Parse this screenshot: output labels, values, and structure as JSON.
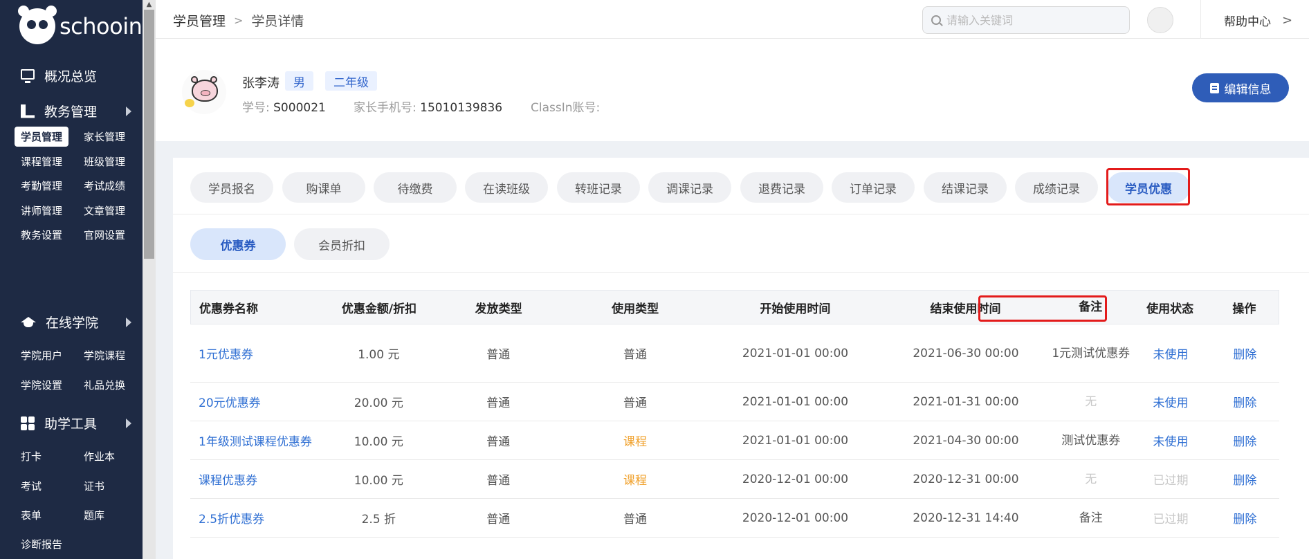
{
  "brand": {
    "name": "schooin"
  },
  "sidebar": {
    "sections": [
      {
        "label": "概况总览",
        "icon": "monitor-icon"
      },
      {
        "label": "教务管理",
        "icon": "book-icon"
      },
      {
        "label": "在线学院",
        "icon": "graduation-cap-icon"
      },
      {
        "label": "助学工具",
        "icon": "grid-icon"
      }
    ],
    "items": [
      "学员管理",
      "家长管理",
      "课程管理",
      "班级管理",
      "考勤管理",
      "考试成绩",
      "讲师管理",
      "文章管理",
      "教务设置",
      "官网设置",
      "学院用户",
      "学院课程",
      "学院设置",
      "礼品兑换",
      "打卡",
      "作业本",
      "考试",
      "证书",
      "表单",
      "题库",
      "诊断报告"
    ]
  },
  "header": {
    "breadcrumb": [
      "学员管理",
      "学员详情"
    ],
    "search_placeholder": "请输入关键词",
    "help": "帮助中心"
  },
  "student": {
    "name": "张李涛",
    "gender": "男",
    "grade": "二年级",
    "id_label": "学号:",
    "id_value": "S000021",
    "phone_label": "家长手机号:",
    "phone_value": "15010139836",
    "classin_label": "ClassIn账号:",
    "classin_value": "",
    "edit_button": "编辑信息"
  },
  "tabs": [
    "学员报名",
    "购课单",
    "待缴费",
    "在读班级",
    "转班记录",
    "调课记录",
    "退费记录",
    "订单记录",
    "结课记录",
    "成绩记录",
    "学员优惠"
  ],
  "active_tab": "学员优惠",
  "subtabs": [
    "优惠券",
    "会员折扣"
  ],
  "active_subtab": "优惠券",
  "table": {
    "columns": [
      "优惠券名称",
      "优惠金额/折扣",
      "发放类型",
      "使用类型",
      "开始使用时间",
      "结束使用时间",
      "备注",
      "使用状态",
      "操作"
    ],
    "rows": [
      {
        "name": "1元优惠券",
        "amount": "1.00 元",
        "issue": "普通",
        "use": "普通",
        "start": "2021-01-01 00:00",
        "end": "2021-06-30 00:00",
        "note": "1元测试优惠券",
        "status": "未使用",
        "action": "删除"
      },
      {
        "name": "20元优惠券",
        "amount": "20.00 元",
        "issue": "普通",
        "use": "普通",
        "start": "2021-01-01 00:00",
        "end": "2021-01-31 00:00",
        "note": "无",
        "status": "未使用",
        "action": "删除"
      },
      {
        "name": "1年级测试课程优惠券",
        "amount": "10.00 元",
        "issue": "普通",
        "use": "课程",
        "start": "2021-01-01 00:00",
        "end": "2021-04-30 00:00",
        "note": "测试优惠券",
        "status": "未使用",
        "action": "删除"
      },
      {
        "name": "课程优惠券",
        "amount": "10.00 元",
        "issue": "普通",
        "use": "课程",
        "start": "2020-12-01 00:00",
        "end": "2020-12-31 00:00",
        "note": "无",
        "status": "已过期",
        "action": "删除"
      },
      {
        "name": "2.5折优惠券",
        "amount": "2.5 折",
        "issue": "普通",
        "use": "普通",
        "start": "2020-12-01 00:00",
        "end": "2020-12-31 14:40",
        "note": "备注",
        "status": "已过期",
        "action": "删除"
      }
    ]
  },
  "colors": {
    "sidebar_bg": "#1e2a44",
    "primary": "#2f5db8",
    "link": "#2f6fd3",
    "orange": "#f0a02a",
    "highlight": "#e31b1b"
  }
}
